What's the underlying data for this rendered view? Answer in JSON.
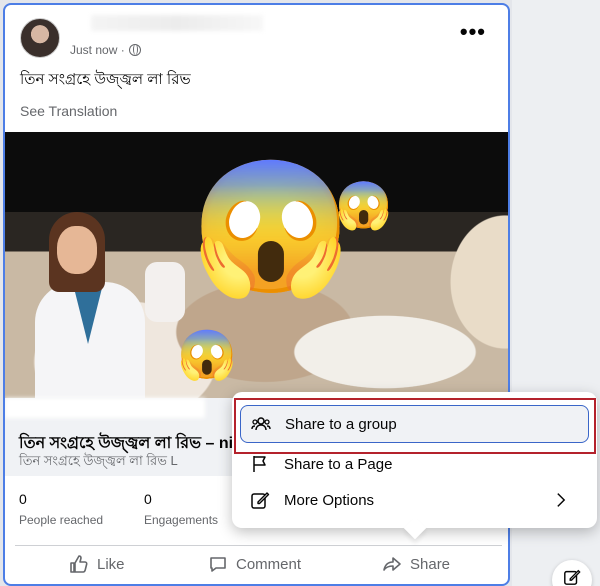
{
  "post": {
    "timestamp": "Just now · ",
    "more_label": "•••",
    "text": "তিন সংগ্রহে উজ্জ্বল লা রিভ",
    "see_translation": "See Translation",
    "image_emoji": "😱",
    "link_title": "তিন সংগ্রহে উজ্জ্বল লা রিভ – ni",
    "link_subtitle": "তিন সংগ্রহে উজ্জ্বল লা রিভ L"
  },
  "stats": {
    "reached_value": "0",
    "reached_label": "People reached",
    "engagements_value": "0",
    "engagements_label": "Engagements"
  },
  "actions": {
    "like": "Like",
    "comment": "Comment",
    "share": "Share"
  },
  "share_menu": {
    "items": [
      {
        "label": "Share to a group",
        "icon": "group-icon"
      },
      {
        "label": "Share to a Page",
        "icon": "flag-icon"
      },
      {
        "label": "More Options",
        "icon": "edit-icon"
      }
    ]
  },
  "colors": {
    "accent_border": "#4d7ee6",
    "highlight_box": "#b4222c",
    "text_secondary": "#65676b"
  }
}
